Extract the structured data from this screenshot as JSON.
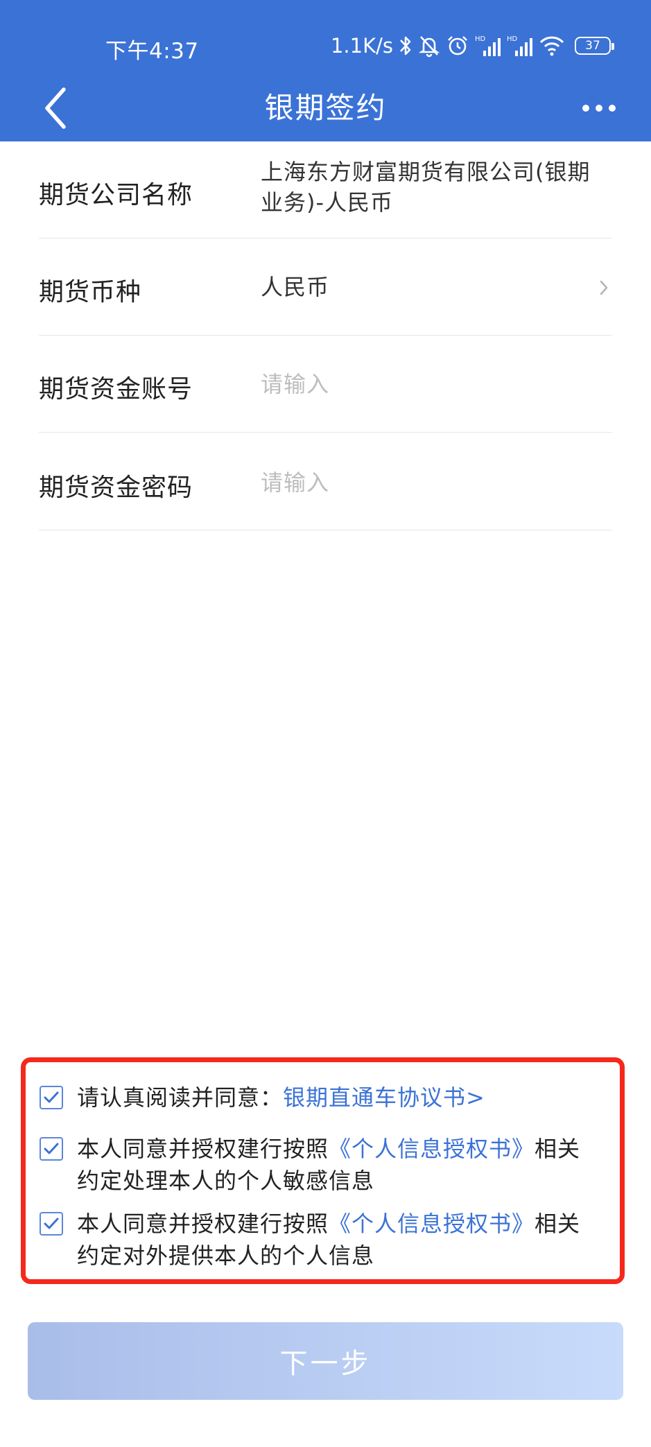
{
  "status_bar": {
    "time": "下午4:37",
    "network_speed": "1.1K/s",
    "signal_badge_1": "HD",
    "signal_badge_2": "HD",
    "battery": "37",
    "icons": [
      "bluetooth-icon",
      "mute-bell-icon",
      "alarm-icon",
      "signal-icon",
      "signal-icon",
      "wifi-icon",
      "battery-icon"
    ]
  },
  "navbar": {
    "title": "银期签约",
    "back_icon": "chevron-left-icon",
    "more_icon": "more-dots-icon"
  },
  "form": {
    "company_label": "期货公司名称",
    "company_value_line1": "上海东方财富期货有限公司(银期",
    "company_value_line2": "业务)-人民币",
    "currency_label": "期货币种",
    "currency_value": "人民币",
    "account_label": "期货资金账号",
    "account_placeholder": "请输入",
    "password_label": "期货资金密码",
    "password_placeholder": "请输入"
  },
  "agreements": {
    "item1_prefix": "请认真阅读并同意：",
    "item1_link": "银期直通车协议书>",
    "item1_checked": true,
    "item2_prefix": "本人同意并授权建行按照",
    "item2_link": "《个人信息授权书》",
    "item2_suffix1": "相关",
    "item2_suffix2": "约定处理本人的个人敏感信息",
    "item2_checked": true,
    "item3_prefix": "本人同意并授权建行按照",
    "item3_link": "《个人信息授权书》",
    "item3_suffix1": "相关",
    "item3_suffix2": "约定对外提供本人的个人信息",
    "item3_checked": true
  },
  "next_button": "下一步",
  "colors": {
    "header_bg": "#3b72d6",
    "link": "#3b72d6",
    "highlight_border": "#f5281c",
    "button_gradient_start": "#a9bde9",
    "button_gradient_end": "#c8dbfb"
  }
}
